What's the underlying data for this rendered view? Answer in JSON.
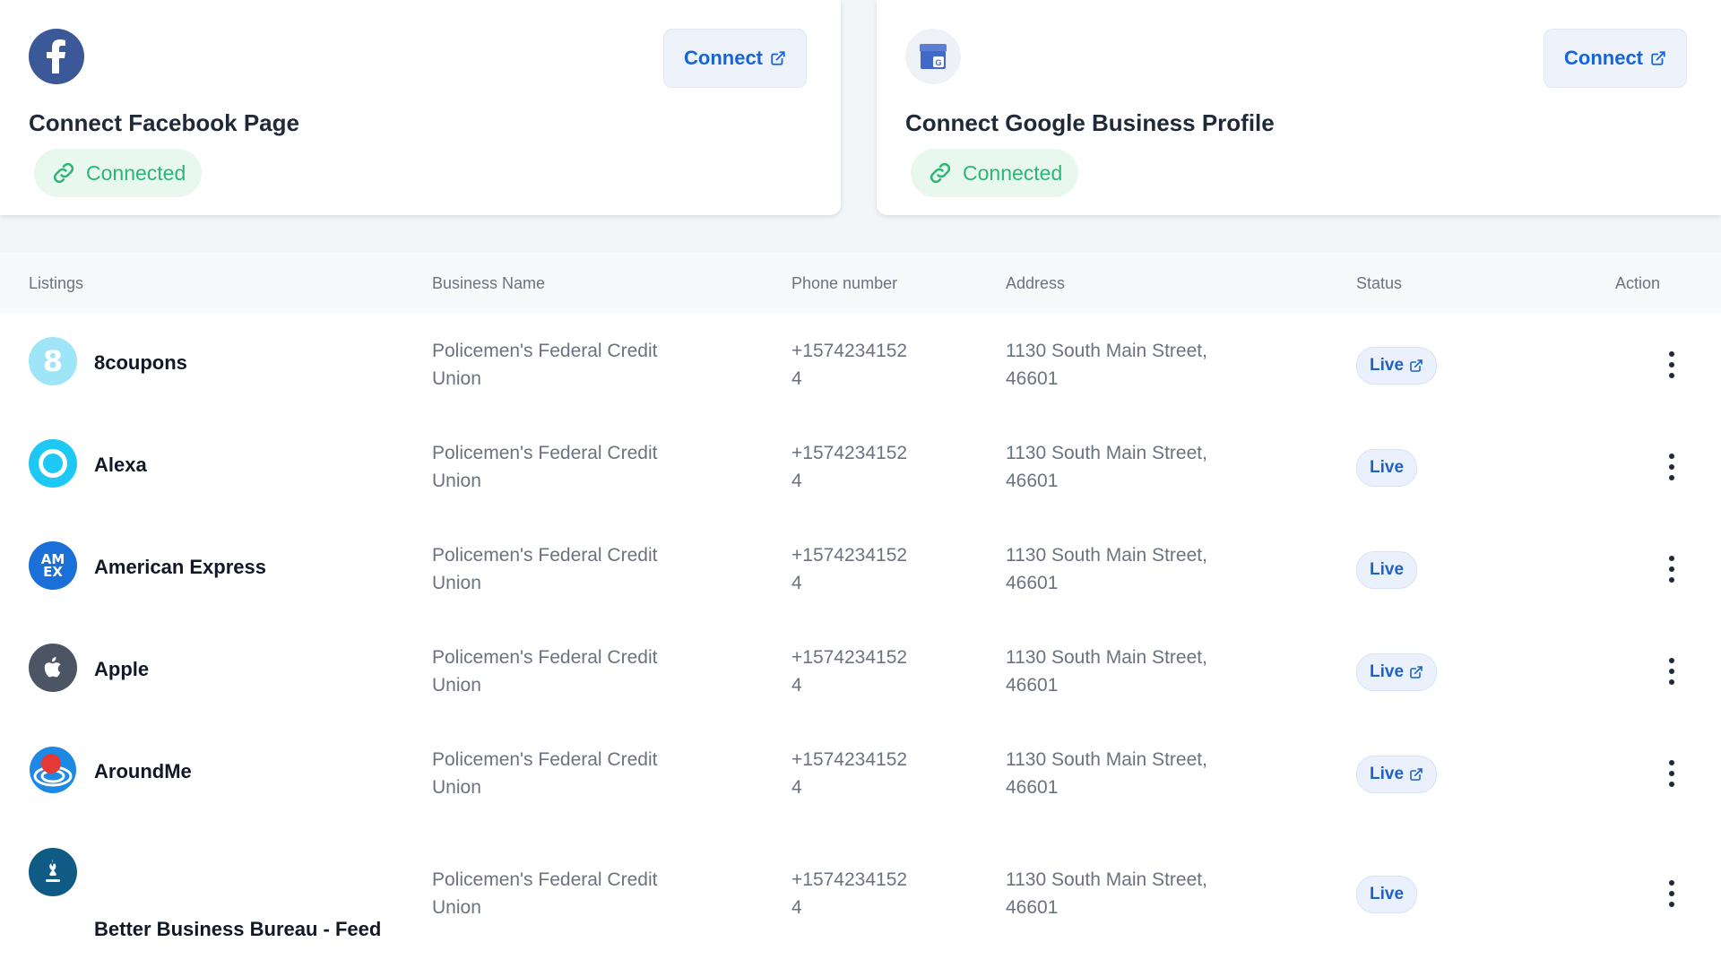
{
  "cards": [
    {
      "title": "Connect Facebook Page",
      "status": "Connected",
      "button": "Connect",
      "icon": "facebook-icon"
    },
    {
      "title": "Connect Google Business Profile",
      "status": "Connected",
      "button": "Connect",
      "icon": "google-business-icon"
    }
  ],
  "table": {
    "headers": {
      "listings": "Listings",
      "business_name": "Business Name",
      "phone": "Phone number",
      "address": "Address",
      "status": "Status",
      "action": "Action"
    },
    "rows": [
      {
        "name": "8coupons",
        "business_line1": "Policemen's Federal Credit",
        "business_line2": "Union",
        "phone_line1": "+1574234152",
        "phone_line2": "4",
        "address_line1": "1130 South Main Street,",
        "address_line2": "46601",
        "status": "Live",
        "external_link": true,
        "icon": "8coupons-icon"
      },
      {
        "name": "Alexa",
        "business_line1": "Policemen's Federal Credit",
        "business_line2": "Union",
        "phone_line1": "+1574234152",
        "phone_line2": "4",
        "address_line1": "1130 South Main Street,",
        "address_line2": "46601",
        "status": "Live",
        "external_link": false,
        "icon": "alexa-icon"
      },
      {
        "name": "American Express",
        "business_line1": "Policemen's Federal Credit",
        "business_line2": "Union",
        "phone_line1": "+1574234152",
        "phone_line2": "4",
        "address_line1": "1130 South Main Street,",
        "address_line2": "46601",
        "status": "Live",
        "external_link": false,
        "icon": "american-express-icon"
      },
      {
        "name": "Apple",
        "business_line1": "Policemen's Federal Credit",
        "business_line2": "Union",
        "phone_line1": "+1574234152",
        "phone_line2": "4",
        "address_line1": "1130 South Main Street,",
        "address_line2": "46601",
        "status": "Live",
        "external_link": true,
        "icon": "apple-icon"
      },
      {
        "name": "AroundMe",
        "business_line1": "Policemen's Federal Credit",
        "business_line2": "Union",
        "phone_line1": "+1574234152",
        "phone_line2": "4",
        "address_line1": "1130 South Main Street,",
        "address_line2": "46601",
        "status": "Live",
        "external_link": true,
        "icon": "aroundme-icon"
      },
      {
        "name": "Better Business Bureau - Feed",
        "business_line1": "Policemen's Federal Credit",
        "business_line2": "Union",
        "phone_line1": "+1574234152",
        "phone_line2": "4",
        "address_line1": "1130 South Main Street,",
        "address_line2": "46601",
        "status": "Live",
        "external_link": false,
        "icon": "bbb-icon"
      }
    ]
  },
  "colors": {
    "accent_blue": "#1565d8",
    "connected_green": "#2bb673",
    "facebook_blue": "#3b5998"
  }
}
